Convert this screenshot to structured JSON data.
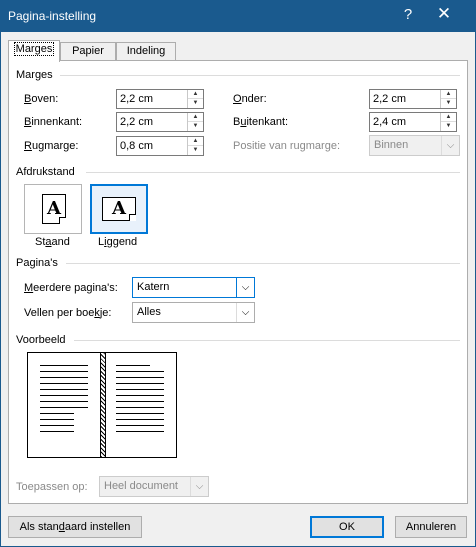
{
  "window": {
    "title": "Pagina-instelling",
    "help": "?",
    "close": "✕"
  },
  "tabs": [
    {
      "label": "Marges"
    },
    {
      "label": "Papier"
    },
    {
      "label": "Indeling"
    }
  ],
  "margins": {
    "group_label": "Marges",
    "top": {
      "label": "Boven:",
      "value": "2,2 cm"
    },
    "bottom": {
      "label": "Onder:",
      "value": "2,2 cm"
    },
    "inside": {
      "label": "Binnenkant:",
      "value": "2,2 cm"
    },
    "outside": {
      "label": "Buitenkant:",
      "value": "2,4 cm"
    },
    "gutter": {
      "label": "Rugmarge:",
      "value": "0,8 cm"
    },
    "gutter_position": {
      "label": "Positie van rugmarge:",
      "value": "Binnen"
    }
  },
  "orientation": {
    "group_label": "Afdrukstand",
    "portrait": "Staand",
    "landscape": "Liggend",
    "icon_letter": "A"
  },
  "pages": {
    "group_label": "Pagina's",
    "multiple": {
      "label": "Meerdere pagina's:",
      "value": "Katern"
    },
    "sheets": {
      "label": "Vellen per boekje:",
      "value": "Alles"
    }
  },
  "preview": {
    "group_label": "Voorbeeld"
  },
  "apply": {
    "label": "Toepassen op:",
    "value": "Heel document"
  },
  "buttons": {
    "default": "Als standaard instellen",
    "ok": "OK",
    "cancel": "Annuleren"
  },
  "colors": {
    "titlebar": "#1a5a8e",
    "accent": "#0078d7"
  },
  "icons": {
    "spin": "spin-arrows",
    "dropdown": "chevron-down-icon"
  }
}
